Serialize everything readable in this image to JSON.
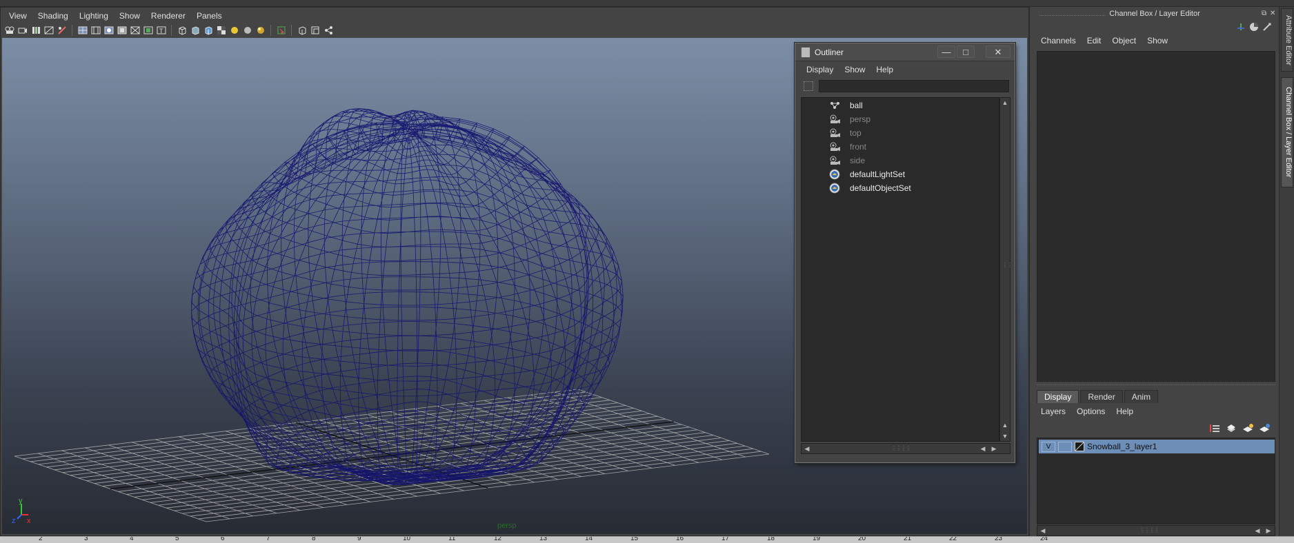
{
  "viewport": {
    "menu": [
      "View",
      "Shading",
      "Lighting",
      "Show",
      "Renderer",
      "Panels"
    ],
    "camera_label": "persp",
    "axis_labels": {
      "y": "y",
      "x": "x",
      "z": "z"
    },
    "colors": {
      "wireframe": "#12126e",
      "grid": "#a8a8a8",
      "axis": "#111111",
      "camera_label": "#2a6a2a"
    },
    "toolbar_icons": [
      "camera-icon",
      "camera-attributes-icon",
      "bookmark-icon",
      "film-gate-icon",
      "grease-pencil-icon",
      "grid-icon",
      "film-gate-view-icon",
      "resolution-gate-icon",
      "gate-mask-icon",
      "field-chart-icon",
      "safe-action-icon",
      "safe-title-icon",
      "wireframe-icon",
      "smooth-shade-icon",
      "textured-icon",
      "use-all-lights-icon",
      "shadows-icon",
      "ambient-occlusion-icon",
      "motion-blur-icon",
      "xray-icon",
      "isolate-select-icon",
      "backface-culling-icon",
      "smooth-wireframe-icon",
      "skeleton-icon"
    ]
  },
  "outliner": {
    "title": "Outliner",
    "menu": [
      "Display",
      "Show",
      "Help"
    ],
    "controls": {
      "minimize": "—",
      "maximize": "□",
      "close": "✕"
    },
    "items": [
      {
        "label": "ball",
        "icon": "transform-icon",
        "dim": false
      },
      {
        "label": "persp",
        "icon": "camera-icon",
        "dim": true
      },
      {
        "label": "top",
        "icon": "camera-icon",
        "dim": true
      },
      {
        "label": "front",
        "icon": "camera-icon",
        "dim": true
      },
      {
        "label": "side",
        "icon": "camera-icon",
        "dim": true
      },
      {
        "label": "defaultLightSet",
        "icon": "set-icon",
        "dim": false
      },
      {
        "label": "defaultObjectSet",
        "icon": "set-icon",
        "dim": false
      }
    ]
  },
  "channel_box": {
    "title": "Channel Box / Layer Editor",
    "menu": [
      "Channels",
      "Edit",
      "Object",
      "Show"
    ]
  },
  "layer_editor": {
    "tabs": [
      "Display",
      "Render",
      "Anim"
    ],
    "active_tab": "Display",
    "menu": [
      "Layers",
      "Options",
      "Help"
    ],
    "layers": [
      {
        "visible": "V",
        "name": "Snowball_3_layer1"
      }
    ],
    "colors": {
      "selected_row": "#6d8eb7"
    }
  },
  "side_tabs": [
    "Attribute Editor",
    "Channel Box / Layer Editor"
  ],
  "timeline": {
    "ticks": [
      "2",
      "3",
      "4",
      "5",
      "6",
      "7",
      "8",
      "9",
      "10",
      "11",
      "12",
      "13",
      "14",
      "15",
      "16",
      "17",
      "18",
      "19",
      "20",
      "21",
      "22",
      "23",
      "24"
    ]
  }
}
